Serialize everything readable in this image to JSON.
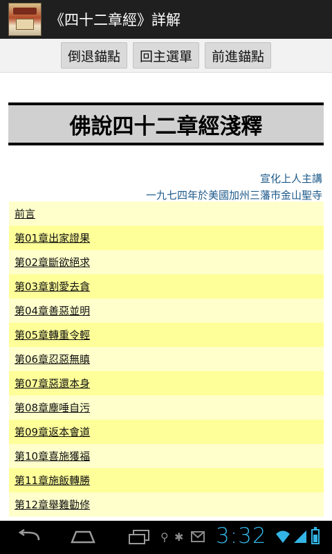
{
  "app": {
    "title": "《四十二章經》詳解"
  },
  "toolbar": {
    "back_anchor": "倒退錨點",
    "main_menu": "回主選單",
    "forward_anchor": "前進錨點"
  },
  "banner": {
    "title": "佛說四十二章經淺釋"
  },
  "credits": {
    "lecturer": "宣化上人主講",
    "venue": "一九七四年於美國加州三藩市金山聖寺"
  },
  "toc": [
    "前言",
    "第01章出家證果",
    "第02章斷欲絕求",
    "第03章割愛去貪",
    "第04章善惡並明",
    "第05章轉重令輕",
    "第06章忍惡無瞋",
    "第07章惡還本身",
    "第08章塵唾自污",
    "第09章返本會道",
    "第10章喜施獲福",
    "第11章施飯轉勝",
    "第12章舉難勸修"
  ],
  "status": {
    "time": "3:32"
  },
  "colors": {
    "link_row_light": "#ffffcc",
    "link_row_dark": "#ffff99",
    "credit_text": "#1e5a8a",
    "clock": "#33b5e5"
  },
  "icons": {
    "app": "temple-icon",
    "nav": [
      "back-icon",
      "home-icon",
      "recent-apps-icon"
    ],
    "status": [
      "usb-icon",
      "debug-icon",
      "gmail-icon",
      "wifi-icon",
      "signal-icon",
      "battery-icon"
    ]
  }
}
